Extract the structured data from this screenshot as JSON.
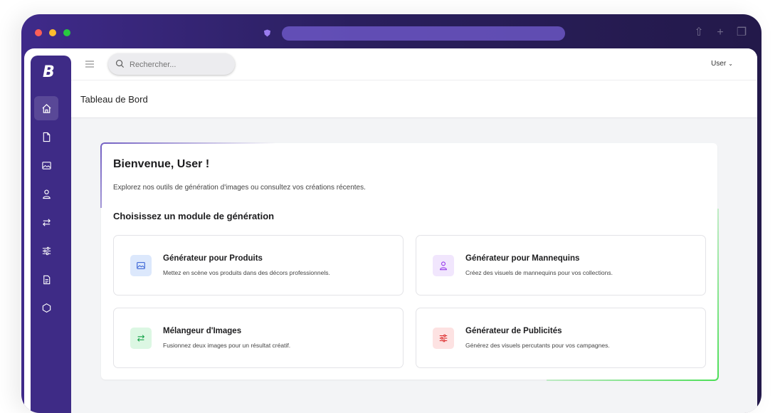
{
  "browser": {
    "url": ""
  },
  "app": {
    "logo_letter": "B"
  },
  "topbar": {
    "search_placeholder": "Rechercher...",
    "user_label": "User"
  },
  "page": {
    "title": "Tableau de Bord"
  },
  "welcome": {
    "heading": "Bienvenue, User !",
    "subtitle": "Explorez nos outils de génération d'images ou consultez vos créations récentes.",
    "section_title": "Choisissez un module de génération"
  },
  "modules": [
    {
      "title": "Générateur pour Produits",
      "description": "Mettez en scène vos produits dans des décors professionnels.",
      "icon": "image-icon",
      "bg": "#dce8fc",
      "fg": "#2f5bd3"
    },
    {
      "title": "Générateur pour Mannequins",
      "description": "Créez des visuels de mannequins pour vos collections.",
      "icon": "person-icon",
      "bg": "#f1e6fd",
      "fg": "#9333ea"
    },
    {
      "title": "Mélangeur d'Images",
      "description": "Fusionnez deux images pour un résultat créatif.",
      "icon": "swap-icon",
      "bg": "#dcf7e3",
      "fg": "#16a34a"
    },
    {
      "title": "Générateur de Publicités",
      "description": "Générez des visuels percutants pour vos campagnes.",
      "icon": "sliders-icon",
      "bg": "#fde2e2",
      "fg": "#dc2626"
    }
  ],
  "sidebar": {
    "items": [
      {
        "icon": "home-icon",
        "active": true
      },
      {
        "icon": "file-icon"
      },
      {
        "icon": "image-icon"
      },
      {
        "icon": "person-icon"
      },
      {
        "icon": "swap-icon"
      },
      {
        "icon": "sliders-icon"
      },
      {
        "icon": "clipboard-icon"
      },
      {
        "icon": "hexagon-icon"
      }
    ]
  },
  "colors": {
    "sidebar": "#3e2b86",
    "accent_purple": "#5a43b8",
    "accent_green": "#4ade55"
  }
}
